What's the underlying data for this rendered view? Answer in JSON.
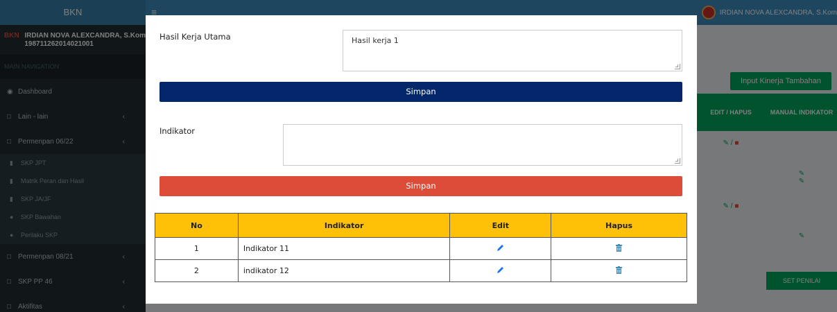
{
  "app": {
    "brand": "BKN",
    "top_user": "IRDIAN NOVA ALEXCANDRA, S.Kom"
  },
  "sidebar": {
    "logo": "BKN",
    "user_name": "IRDIAN NOVA ALEXCANDRA, S.Kom",
    "user_nip": "198711262014021001",
    "nav_header": "MAIN NAVIGATION",
    "items": [
      {
        "label": "Dashboard"
      },
      {
        "label": "Lain - lain"
      },
      {
        "label": "Permenpan 06/22"
      },
      {
        "label": "SKP JPT"
      },
      {
        "label": "Matrik Peran dan Hasil"
      },
      {
        "label": "SKP JA/JF"
      },
      {
        "label": "SKP Bawahan"
      },
      {
        "label": "Perilaku SKP"
      },
      {
        "label": "Permenpan 08/21"
      },
      {
        "label": "SKP PP 46"
      },
      {
        "label": "Aktifitas"
      }
    ]
  },
  "background": {
    "btn_tambahan": "Input Kinerja Tambahan",
    "col_edit_hapus": "EDIT / HAPUS",
    "col_manual": "MANUAL INDIKATOR",
    "set_penilai": "SET PENILAI"
  },
  "modal": {
    "hasil_label": "Hasil Kerja Utama",
    "hasil_value": "Hasil kerja 1",
    "simpan1": "Simpan",
    "indikator_label": "Indikator",
    "indikator_value": "",
    "simpan2": "Simpan",
    "table": {
      "headers": [
        "No",
        "Indikator",
        "Edit",
        "Hapus"
      ],
      "rows": [
        {
          "no": "1",
          "indikator": "Indikator 11"
        },
        {
          "no": "2",
          "indikator": "indikator 12"
        }
      ]
    }
  },
  "colors": {
    "primary_dark_blue": "#04276b",
    "danger_red": "#dd4b39",
    "table_header_yellow": "#ffc107",
    "success_green": "#00a65a",
    "sidebar_dark": "#222d32"
  }
}
